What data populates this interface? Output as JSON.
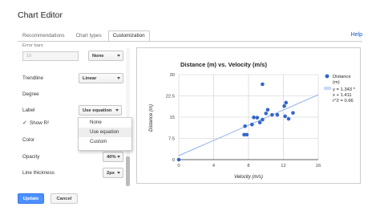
{
  "dialog": {
    "title": "Chart Editor",
    "help": "Help"
  },
  "tabs": [
    {
      "label": "Recommendations"
    },
    {
      "label": "Chart types"
    },
    {
      "label": "Customization"
    }
  ],
  "panel": {
    "error_bars_label": "Error bars",
    "error_bars_value": "10",
    "error_bars_type": "None",
    "trendline_label": "Trendline",
    "trendline_value": "Linear",
    "degree_label": "Degree",
    "label_label": "Label",
    "label_value": "Use equation",
    "show_r2_check": "✓",
    "show_r2_label": "Show R²",
    "color_label": "Color",
    "opacity_label": "Opacity",
    "opacity_value": "40%",
    "line_thickness_label": "Line thickness",
    "line_thickness_value": "2px"
  },
  "dropdown": {
    "options": [
      "None",
      "Use equation",
      "Custom"
    ],
    "highlighted": "Use equation"
  },
  "chart_data": {
    "type": "scatter",
    "title": "Distance (m) vs. Velocity (m/s)",
    "xlabel": "Velocity (m/s)",
    "ylabel": "Distance (m)",
    "xlim": [
      0,
      16
    ],
    "ylim": [
      0,
      30
    ],
    "xticks": [
      "0",
      "4",
      "8",
      "12",
      "16"
    ],
    "yticks": [
      "0",
      "7.5",
      "15",
      "22.5",
      "30"
    ],
    "color": "#3366cc",
    "trendline_color": "#8fb0e8",
    "points": [
      [
        0,
        0
      ],
      [
        7.5,
        8.8
      ],
      [
        7.8,
        8.8
      ],
      [
        7.6,
        11.8
      ],
      [
        8.4,
        12.4
      ],
      [
        8.6,
        14.9
      ],
      [
        9,
        14.8
      ],
      [
        9.3,
        13.1
      ],
      [
        9.6,
        14.1
      ],
      [
        9.6,
        26.6
      ],
      [
        10,
        16.3
      ],
      [
        10.2,
        17.6
      ],
      [
        10.7,
        15.8
      ],
      [
        11.3,
        15.8
      ],
      [
        12.1,
        18.9
      ],
      [
        12.2,
        15.3
      ],
      [
        12.6,
        14.4
      ],
      [
        12.3,
        20.1
      ],
      [
        13.1,
        16.5
      ]
    ],
    "legend": [
      {
        "label": "Distance (m)"
      },
      {
        "label": "y = 1.343 * x + 1.411 r^2 = 0.66"
      }
    ],
    "trendline": {
      "slope": 1.343,
      "intercept": 1.411
    }
  },
  "footer": {
    "update": "Update",
    "cancel": "Cancel"
  }
}
